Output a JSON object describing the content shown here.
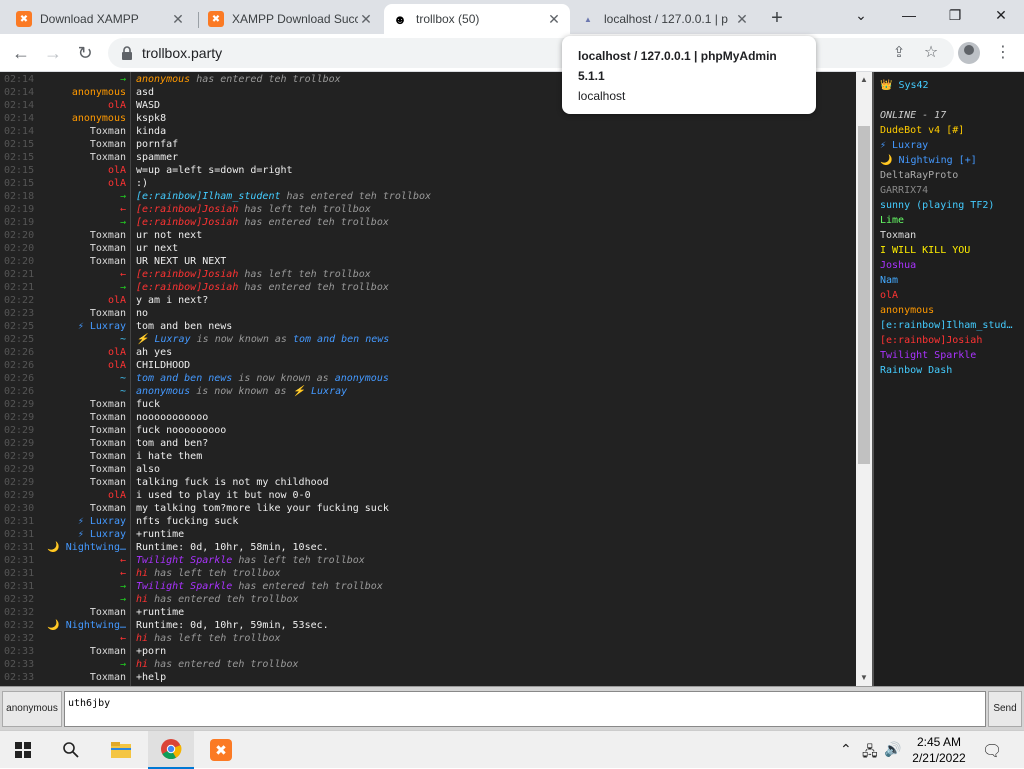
{
  "browser": {
    "tabs": [
      {
        "title": "Download XAMPP",
        "favicon": "xampp-icon",
        "active": false
      },
      {
        "title": "XAMPP Download Succ",
        "favicon": "xampp-icon",
        "active": false
      },
      {
        "title": "trollbox (50)",
        "favicon": "troll-icon",
        "active": true
      },
      {
        "title": "localhost / 127.0.0.1 | p",
        "favicon": "phpmyadmin-icon",
        "active": false
      }
    ],
    "url": "trollbox.party",
    "tooltip": {
      "title_line1": "localhost / 127.0.0.1 | phpMyAdmin",
      "title_line2": "5.1.1",
      "host": "localhost"
    }
  },
  "chat": {
    "messages": [
      {
        "time": "02:14",
        "nick": "→",
        "nick_color": "#22cc22",
        "text": "anonymous",
        "text_color": "#ff9900",
        "suffix": " has entered teh trollbox",
        "system": true
      },
      {
        "time": "02:14",
        "nick": "anonymous",
        "nick_color": "#ff9900",
        "text": "asd"
      },
      {
        "time": "02:14",
        "nick": "olA",
        "nick_color": "#ff3333",
        "text": "WASD"
      },
      {
        "time": "02:14",
        "nick": "anonymous",
        "nick_color": "#ff9900",
        "text": "kspk8"
      },
      {
        "time": "02:14",
        "nick": "Toxman",
        "nick_color": "#dddddd",
        "text": "kinda"
      },
      {
        "time": "02:15",
        "nick": "Toxman",
        "nick_color": "#dddddd",
        "text": "pornfaf"
      },
      {
        "time": "02:15",
        "nick": "Toxman",
        "nick_color": "#dddddd",
        "text": "spammer"
      },
      {
        "time": "02:15",
        "nick": "olA",
        "nick_color": "#ff3333",
        "text": "w=up a=left s=down d=right"
      },
      {
        "time": "02:15",
        "nick": "olA",
        "nick_color": "#ff3333",
        "text": ":)"
      },
      {
        "time": "02:18",
        "nick": "→",
        "nick_color": "#22cc22",
        "text": "[e:rainbow]Ilham_student",
        "text_color": "#44ccff",
        "suffix": " has entered teh trollbox",
        "system": true
      },
      {
        "time": "02:19",
        "nick": "←",
        "nick_color": "#ff3333",
        "text": "[e:rainbow]Josiah",
        "text_color": "#ff3333",
        "suffix": " has left teh trollbox",
        "system": true
      },
      {
        "time": "02:19",
        "nick": "→",
        "nick_color": "#22cc22",
        "text": "[e:rainbow]Josiah",
        "text_color": "#ff3333",
        "suffix": " has entered teh trollbox",
        "system": true
      },
      {
        "time": "02:20",
        "nick": "Toxman",
        "nick_color": "#dddddd",
        "text": "ur not next"
      },
      {
        "time": "02:20",
        "nick": "Toxman",
        "nick_color": "#dddddd",
        "text": "ur next"
      },
      {
        "time": "02:20",
        "nick": "Toxman",
        "nick_color": "#dddddd",
        "text": "UR NEXT UR NEXT"
      },
      {
        "time": "02:21",
        "nick": "←",
        "nick_color": "#ff3333",
        "text": "[e:rainbow]Josiah",
        "text_color": "#ff3333",
        "suffix": " has left teh trollbox",
        "system": true
      },
      {
        "time": "02:21",
        "nick": "→",
        "nick_color": "#22cc22",
        "text": "[e:rainbow]Josiah",
        "text_color": "#ff3333",
        "suffix": " has entered teh trollbox",
        "system": true
      },
      {
        "time": "02:22",
        "nick": "olA",
        "nick_color": "#ff3333",
        "text": "y am i next?"
      },
      {
        "time": "02:23",
        "nick": "Toxman",
        "nick_color": "#dddddd",
        "text": "no"
      },
      {
        "time": "02:25",
        "nick": "⚡ Luxray",
        "nick_color": "#4499ff",
        "text": "tom and ben news"
      },
      {
        "time": "02:25",
        "nick": "~",
        "nick_color": "#44ccff",
        "text": "⚡ Luxray",
        "text_color": "#4499ff",
        "suffix": " is now known as ",
        "suffix2": "tom and ben news",
        "suffix2_color": "#4499ff",
        "system": true
      },
      {
        "time": "02:26",
        "nick": "olA",
        "nick_color": "#ff3333",
        "text": "ah yes"
      },
      {
        "time": "02:26",
        "nick": "olA",
        "nick_color": "#ff3333",
        "text": "CHILDHOOD"
      },
      {
        "time": "02:26",
        "nick": "~",
        "nick_color": "#44ccff",
        "text": "tom and ben news",
        "text_color": "#4499ff",
        "suffix": " is now known as ",
        "suffix2": "anonymous",
        "suffix2_color": "#4499ff",
        "system": true
      },
      {
        "time": "02:26",
        "nick": "~",
        "nick_color": "#44ccff",
        "text": "anonymous",
        "text_color": "#4499ff",
        "suffix": " is now known as ",
        "suffix2": "⚡ Luxray",
        "suffix2_color": "#4499ff",
        "system": true
      },
      {
        "time": "02:29",
        "nick": "Toxman",
        "nick_color": "#dddddd",
        "text": "fuck"
      },
      {
        "time": "02:29",
        "nick": "Toxman",
        "nick_color": "#dddddd",
        "text": "nooooooooooo"
      },
      {
        "time": "02:29",
        "nick": "Toxman",
        "nick_color": "#dddddd",
        "text": "fuck nooooooooo"
      },
      {
        "time": "02:29",
        "nick": "Toxman",
        "nick_color": "#dddddd",
        "text": "tom and ben?"
      },
      {
        "time": "02:29",
        "nick": "Toxman",
        "nick_color": "#dddddd",
        "text": "i hate them"
      },
      {
        "time": "02:29",
        "nick": "Toxman",
        "nick_color": "#dddddd",
        "text": "also"
      },
      {
        "time": "02:29",
        "nick": "Toxman",
        "nick_color": "#dddddd",
        "text": "talking fuck is not my childhood"
      },
      {
        "time": "02:29",
        "nick": "olA",
        "nick_color": "#ff3333",
        "text": "i used to play it but now 0-0"
      },
      {
        "time": "02:30",
        "nick": "Toxman",
        "nick_color": "#dddddd",
        "text": "my talking tom?more like your fucking suck"
      },
      {
        "time": "02:31",
        "nick": "⚡ Luxray",
        "nick_color": "#4499ff",
        "text": "nfts fucking suck"
      },
      {
        "time": "02:31",
        "nick": "⚡ Luxray",
        "nick_color": "#4499ff",
        "text": "+runtime"
      },
      {
        "time": "02:31",
        "nick": "🌙 Nightwing…",
        "nick_color": "#4499ff",
        "text": "Runtime: 0d, 10hr, 58min, 10sec."
      },
      {
        "time": "02:31",
        "nick": "←",
        "nick_color": "#ff3333",
        "text": "Twilight Sparkle",
        "text_color": "#aa33ff",
        "suffix": " has left teh trollbox",
        "system": true
      },
      {
        "time": "02:31",
        "nick": "←",
        "nick_color": "#ff3333",
        "text": "hi",
        "text_color": "#ff3333",
        "suffix": " has left teh trollbox",
        "system": true
      },
      {
        "time": "02:31",
        "nick": "→",
        "nick_color": "#22cc22",
        "text": "Twilight Sparkle",
        "text_color": "#aa33ff",
        "suffix": " has entered teh trollbox",
        "system": true
      },
      {
        "time": "02:32",
        "nick": "→",
        "nick_color": "#22cc22",
        "text": "hi",
        "text_color": "#ff3333",
        "suffix": " has entered teh trollbox",
        "system": true
      },
      {
        "time": "02:32",
        "nick": "Toxman",
        "nick_color": "#dddddd",
        "text": "+runtime"
      },
      {
        "time": "02:32",
        "nick": "🌙 Nightwing…",
        "nick_color": "#4499ff",
        "text": "Runtime: 0d, 10hr, 59min, 53sec."
      },
      {
        "time": "02:32",
        "nick": "←",
        "nick_color": "#ff3333",
        "text": "hi",
        "text_color": "#ff3333",
        "suffix": " has left teh trollbox",
        "system": true
      },
      {
        "time": "02:33",
        "nick": "Toxman",
        "nick_color": "#dddddd",
        "text": "+porn"
      },
      {
        "time": "02:33",
        "nick": "→",
        "nick_color": "#22cc22",
        "text": "hi",
        "text_color": "#ff3333",
        "suffix": " has entered teh trollbox",
        "system": true
      },
      {
        "time": "02:33",
        "nick": "Toxman",
        "nick_color": "#dddddd",
        "text": "+help"
      }
    ]
  },
  "sidebar": {
    "header": "👑 Sys42",
    "header_color": "#44ccff",
    "online_label": "ONLINE - 17",
    "users": [
      {
        "name": "DudeBot v4 [#]",
        "color": "#ffcc00"
      },
      {
        "name": "⚡ Luxray",
        "color": "#4499ff"
      },
      {
        "name": "🌙 Nightwing [+]",
        "color": "#4499ff"
      },
      {
        "name": "DeltaRayProto",
        "color": "#aaaaaa"
      },
      {
        "name": "GARRIX74",
        "color": "#888888"
      },
      {
        "name": "sunny (playing TF2)",
        "color": "#44ccff"
      },
      {
        "name": "Lime",
        "color": "#66ff66"
      },
      {
        "name": "Toxman",
        "color": "#dddddd"
      },
      {
        "name": "I WILL KILL YOU",
        "color": "#ffee00"
      },
      {
        "name": "Joshua",
        "color": "#aa33ff"
      },
      {
        "name": "Nam",
        "color": "#44aaff"
      },
      {
        "name": "olA",
        "color": "#ff3333"
      },
      {
        "name": "anonymous",
        "color": "#ff9900"
      },
      {
        "name": "[e:rainbow]Ilham_student",
        "color": "#44ccff"
      },
      {
        "name": "[e:rainbow]Josiah",
        "color": "#ff3333"
      },
      {
        "name": "Twilight Sparkle",
        "color": "#aa33ff"
      },
      {
        "name": "Rainbow Dash",
        "color": "#44ccff"
      }
    ]
  },
  "input": {
    "nick_label": "anonymous",
    "value": "uth6jby",
    "send_label": "Send"
  },
  "taskbar": {
    "time": "2:45 AM",
    "date": "2/21/2022"
  }
}
